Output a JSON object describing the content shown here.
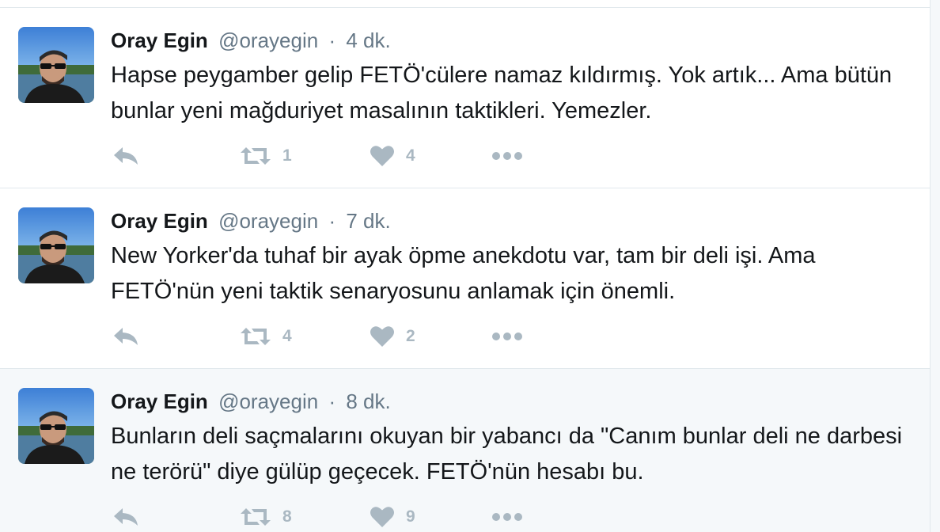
{
  "colors": {
    "text": "#14171a",
    "secondary": "#657786",
    "icon": "#aab8c2",
    "border": "#e1e8ed",
    "hover_bg": "#f5f8fa"
  },
  "tweets": [
    {
      "name": "Oray Egin",
      "handle": "@orayegin",
      "dot": "·",
      "time": "4 dk.",
      "text": "Hapse peygamber gelip FETÖ'cülere namaz kıldırmış. Yok artık... Ama bütün bunlar yeni mağduriyet masalının taktikleri. Yemezler.",
      "retweets": "1",
      "likes": "4"
    },
    {
      "name": "Oray Egin",
      "handle": "@orayegin",
      "dot": "·",
      "time": "7 dk.",
      "text": "New Yorker'da tuhaf bir ayak öpme anekdotu var, tam bir deli işi. Ama FETÖ'nün yeni taktik senaryosunu anlamak için önemli.",
      "retweets": "4",
      "likes": "2"
    },
    {
      "name": "Oray Egin",
      "handle": "@orayegin",
      "dot": "·",
      "time": "8 dk.",
      "text": "Bunların deli saçmalarını okuyan bir yabancı da \"Canım bunlar deli ne darbesi ne terörü\" diye gülüp geçecek. FETÖ'nün hesabı bu.",
      "retweets": "8",
      "likes": "9"
    }
  ],
  "icons": {
    "reply": "reply-icon",
    "retweet": "retweet-icon",
    "like": "heart-icon",
    "more": "more-icon"
  }
}
